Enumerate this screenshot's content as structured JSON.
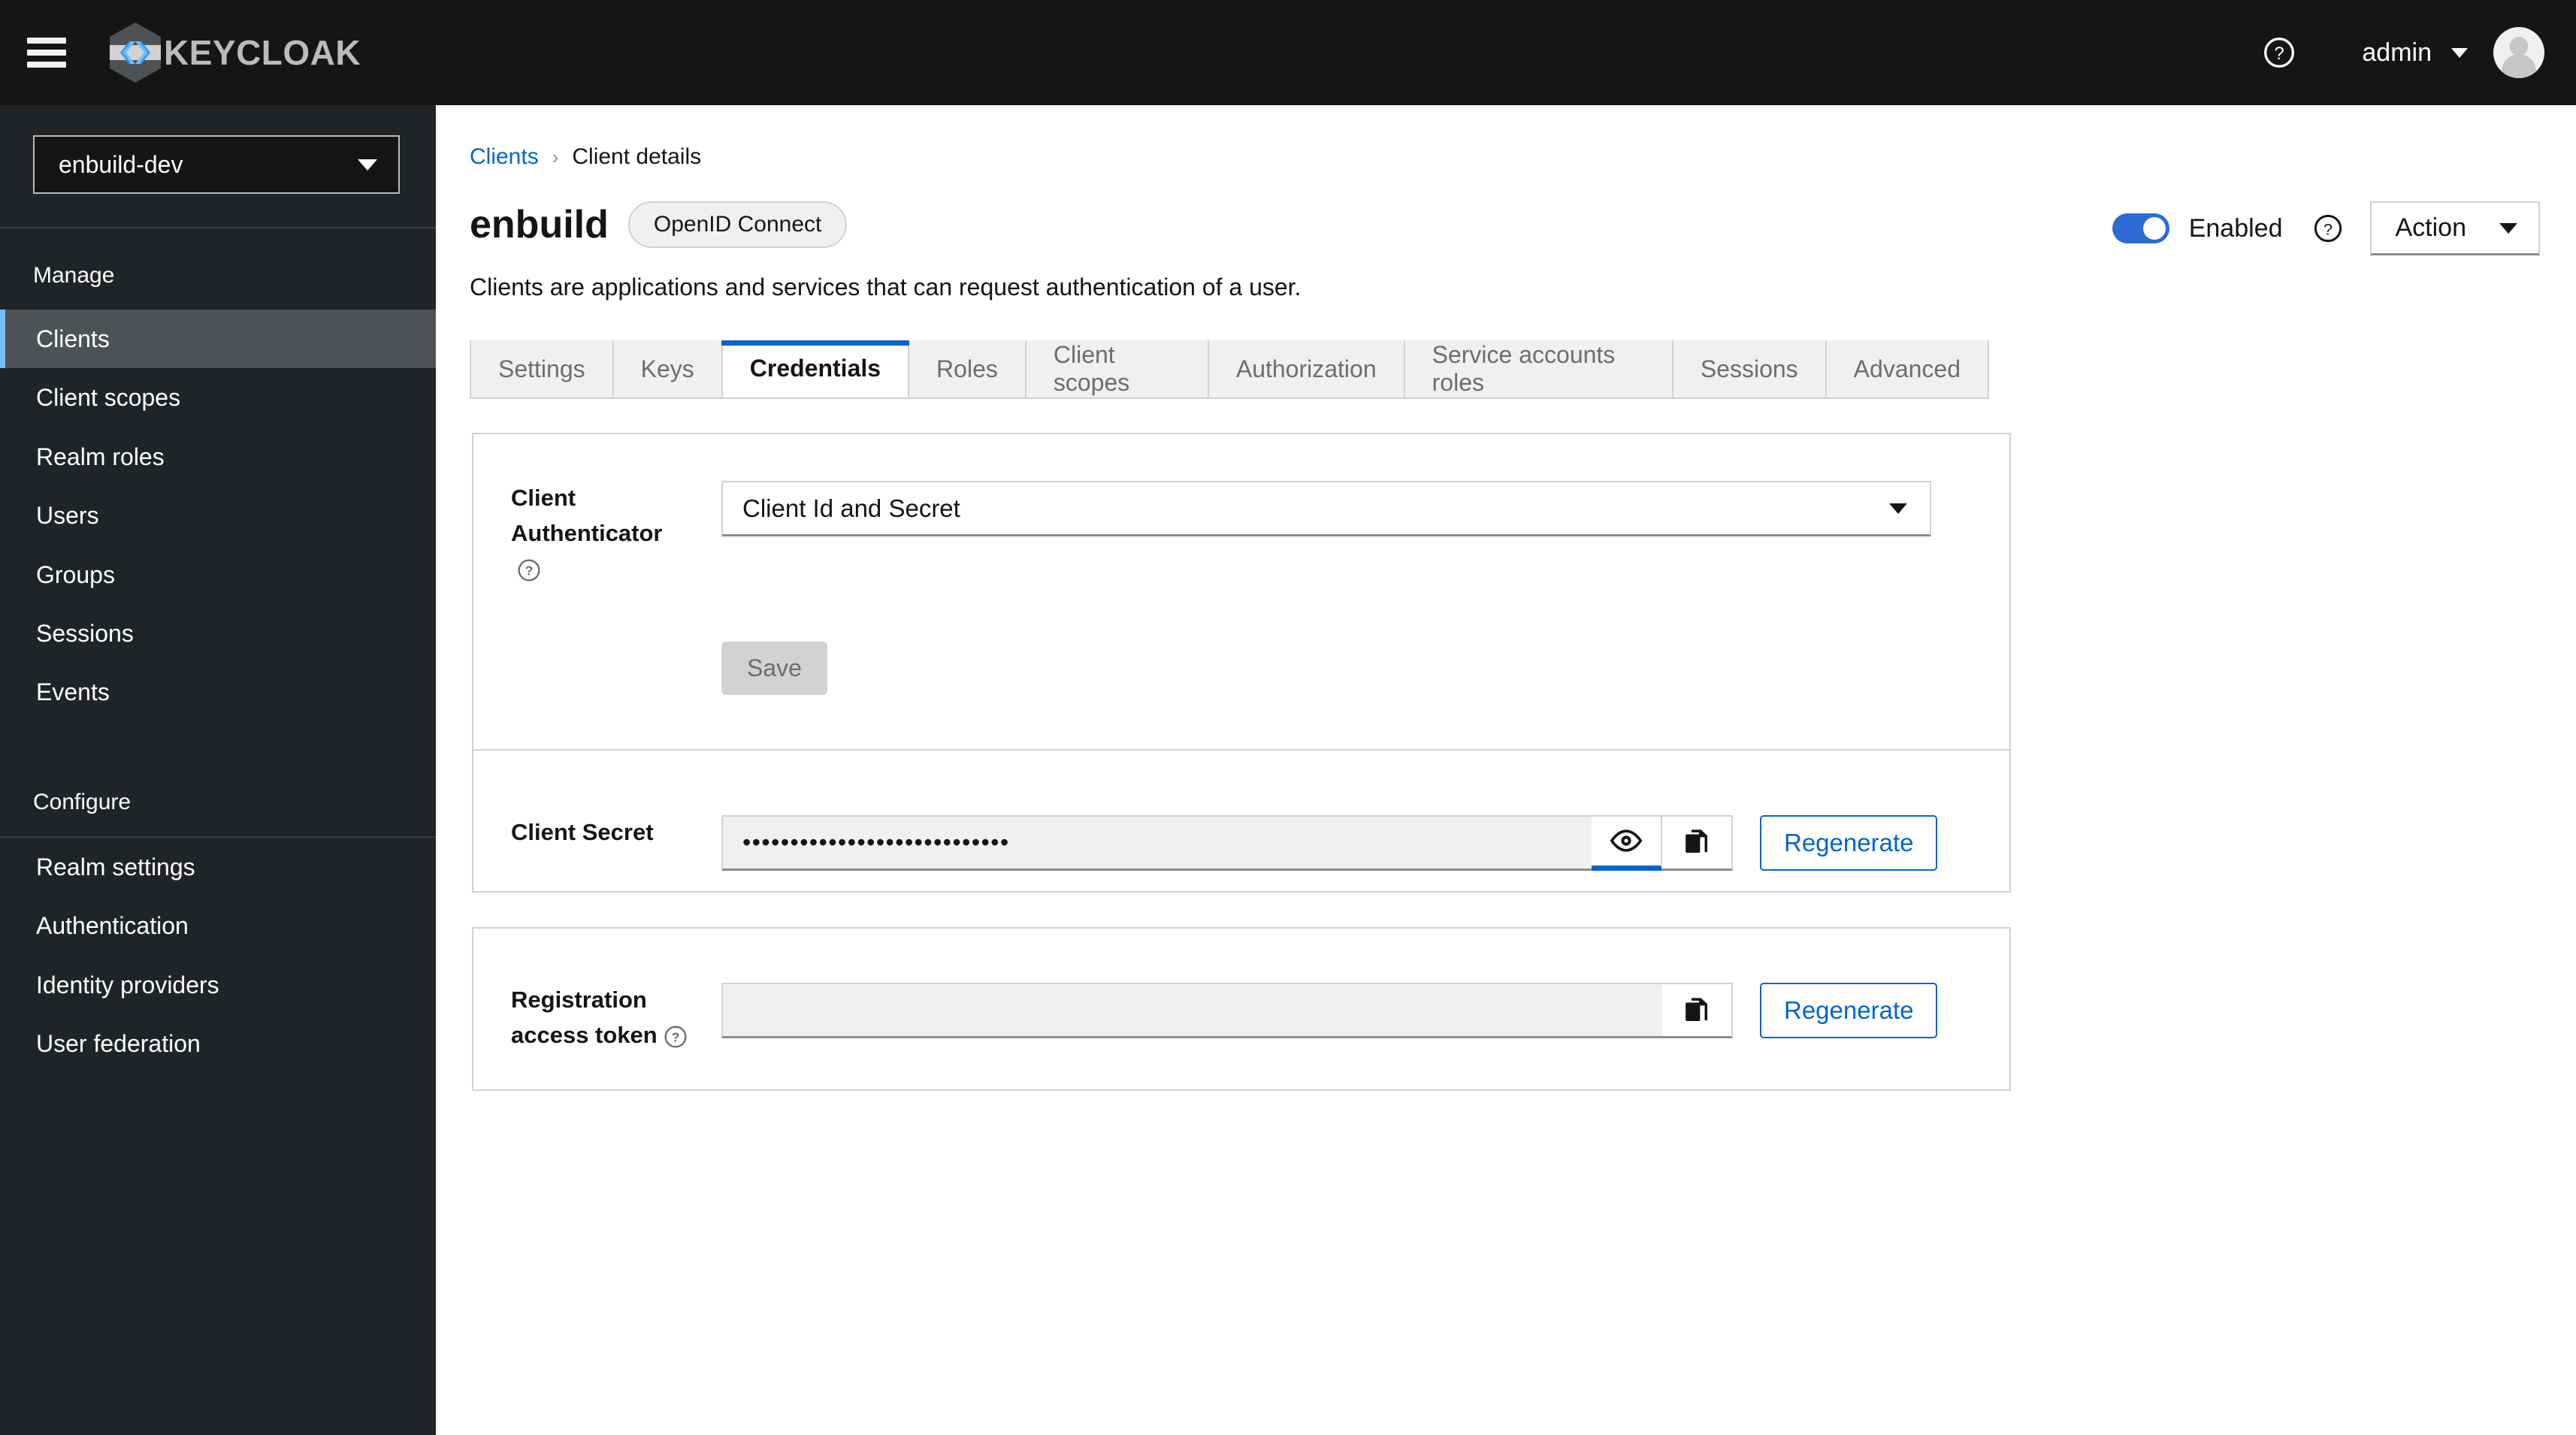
{
  "masthead": {
    "hamburger_icon": "hamburger-menu-icon",
    "brand_logo_icon": "keycloak-logo-icon",
    "brand_text": "KEYCLOAK",
    "help_icon": "help-circle-icon",
    "user_name": "admin",
    "user_caret_icon": "caret-down-icon",
    "avatar_icon": "user-avatar-icon"
  },
  "sidebar": {
    "realm_selector": {
      "value": "enbuild-dev",
      "caret_icon": "caret-down-icon"
    },
    "groups": [
      {
        "label": "Manage",
        "items": [
          {
            "label": "Clients",
            "active": true
          },
          {
            "label": "Client scopes",
            "active": false
          },
          {
            "label": "Realm roles",
            "active": false
          },
          {
            "label": "Users",
            "active": false
          },
          {
            "label": "Groups",
            "active": false
          },
          {
            "label": "Sessions",
            "active": false
          },
          {
            "label": "Events",
            "active": false
          }
        ]
      },
      {
        "label": "Configure",
        "items": [
          {
            "label": "Realm settings",
            "active": false
          },
          {
            "label": "Authentication",
            "active": false
          },
          {
            "label": "Identity providers",
            "active": false
          },
          {
            "label": "User federation",
            "active": false
          }
        ]
      }
    ]
  },
  "breadcrumb": {
    "parent": "Clients",
    "separator": "›",
    "current": "Client details"
  },
  "header": {
    "title": "enbuild",
    "badge": "OpenID Connect",
    "subtitle": "Clients are applications and services that can request authentication of a user.",
    "enabled_toggle": {
      "label": "Enabled",
      "on": true,
      "accent_color": "#2b6bd3"
    },
    "help_icon": "help-circle-icon",
    "action_menu": {
      "label": "Action",
      "caret_icon": "caret-down-icon"
    }
  },
  "tabs": [
    {
      "label": "Settings",
      "active": false
    },
    {
      "label": "Keys",
      "active": false
    },
    {
      "label": "Credentials",
      "active": true
    },
    {
      "label": "Roles",
      "active": false
    },
    {
      "label": "Client scopes",
      "active": false
    },
    {
      "label": "Authorization",
      "active": false
    },
    {
      "label": "Service accounts roles",
      "active": false
    },
    {
      "label": "Sessions",
      "active": false
    },
    {
      "label": "Advanced",
      "active": false
    }
  ],
  "credentials": {
    "client_authenticator": {
      "label": "Client Authenticator",
      "help_icon": "help-circle-icon",
      "selected": "Client Id and Secret",
      "caret_icon": "caret-down-icon"
    },
    "save_button": {
      "label": "Save",
      "disabled": true
    },
    "client_secret": {
      "label": "Client Secret",
      "value": "••••••••••••••••••••••••••••",
      "reveal_icon": "eye-icon",
      "copy_icon": "copy-icon",
      "regenerate_label": "Regenerate"
    }
  },
  "registration_access_token": {
    "label": "Registration access token",
    "help_icon": "help-circle-icon",
    "value": "",
    "copy_icon": "copy-icon",
    "regenerate_label": "Regenerate"
  },
  "colors": {
    "masthead_bg": "#151515",
    "sidebar_bg": "#212427",
    "link_blue": "#0066cc",
    "accent_blue": "#2b6bd3",
    "active_nav_bar": "#73bcf7"
  }
}
